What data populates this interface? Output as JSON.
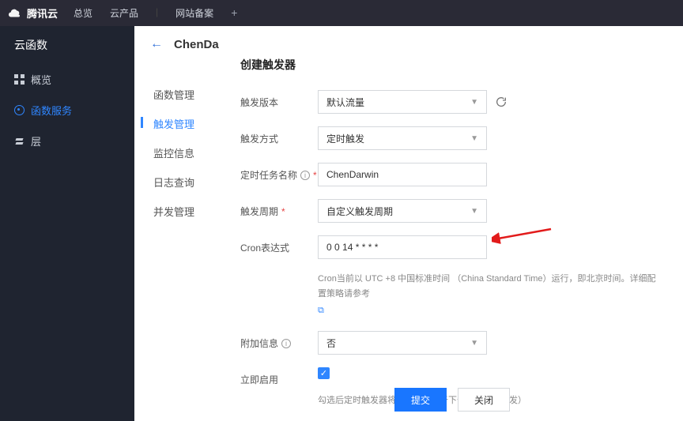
{
  "brand": "腾讯云",
  "topnav": {
    "overview": "总览",
    "products": "云产品",
    "beian": "网站备案"
  },
  "sidebar": {
    "title": "云函数",
    "items": [
      {
        "label": "概览"
      },
      {
        "label": "函数服务"
      },
      {
        "label": "层"
      }
    ]
  },
  "page": {
    "back_target": "ChenDa"
  },
  "subnav": {
    "items": [
      {
        "label": "函数管理"
      },
      {
        "label": "触发管理"
      },
      {
        "label": "监控信息"
      },
      {
        "label": "日志查询"
      },
      {
        "label": "并发管理"
      }
    ]
  },
  "modal": {
    "title": "创建触发器",
    "labels": {
      "version": "触发版本",
      "method": "触发方式",
      "task_name": "定时任务名称",
      "period": "触发周期",
      "cron": "Cron表达式",
      "extra": "附加信息",
      "enable": "立即启用"
    },
    "values": {
      "version": "默认流量",
      "method": "定时触发",
      "task_name": "ChenDarwin",
      "period": "自定义触发周期",
      "cron": "0 0 14 * * * *",
      "extra": "否"
    },
    "help": {
      "cron": "Cron当前以 UTC +8 中国标准时间 （China Standard Time）运行，即北京时间。详细配置策略请参考",
      "enable": "勾选后定时触发器将立即开启（于下个配置周期触发）"
    },
    "footer": {
      "submit": "提交",
      "cancel": "关闭"
    }
  }
}
